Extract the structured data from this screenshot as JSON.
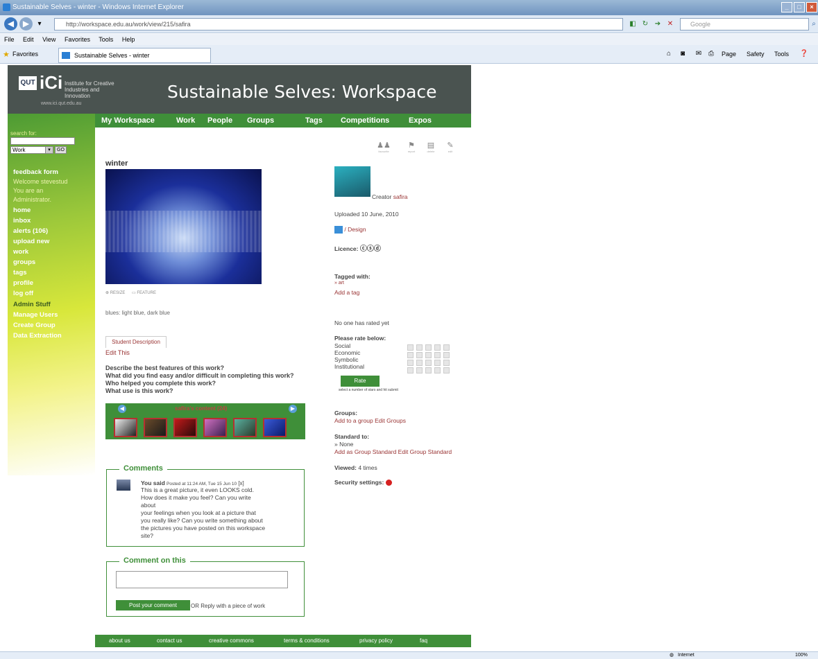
{
  "browser": {
    "title": "Sustainable Selves - winter - Windows Internet Explorer",
    "url": "http://workspace.edu.au/work/view/215/safira",
    "search_placeholder": "Google",
    "menu": [
      "File",
      "Edit",
      "View",
      "Favorites",
      "Tools",
      "Help"
    ],
    "favorites_label": "Favorites",
    "tab_title": "Sustainable Selves - winter",
    "command_items": [
      "Page",
      "Safety",
      "Tools"
    ],
    "status_zone": "Internet",
    "zoom": "100%"
  },
  "header": {
    "qut": "QUT",
    "ici": "iCi",
    "institute": "Institute for Creative Industries and Innovation",
    "site_url": "www.ici.qut.edu.au",
    "site_title": "Sustainable Selves: Workspace"
  },
  "topnav": [
    "My Workspace",
    "Work",
    "People",
    "Groups",
    "Tags",
    "Competitions",
    "Expos"
  ],
  "sidebar": {
    "search_label": "search for:",
    "search_type": "Work",
    "go_label": "GO",
    "feedback": "feedback form",
    "welcome": "Welcome stevestud",
    "admin_note_1": "You are an",
    "admin_note_2": "Administrator.",
    "links": [
      "home",
      "inbox",
      "alerts (106)",
      "upload new",
      "work",
      "groups",
      "tags",
      "profile",
      "log off"
    ],
    "admin_stuff": "Admin Stuff",
    "admin_links": [
      "Manage Users",
      "Create Group",
      "Data Extraction"
    ]
  },
  "work": {
    "title": "winter",
    "action_icons": [
      "favourite",
      "report",
      "delete",
      "edit"
    ],
    "media_controls": [
      "RESIZE",
      "FEATURE"
    ],
    "tags_line": "blues: light blue, dark blue",
    "tab_label": "Student Description",
    "edit_label": "Edit This",
    "questions": [
      "Describe the best features of this work?",
      "What did you find easy and/or difficult in completing this work?",
      "Who helped you complete this work?",
      "What use is this work?"
    ],
    "carousel_title": "safira's content (24)"
  },
  "comments": {
    "legend": "Comments",
    "author": "You said",
    "posted": "Posted at 11:24 AM, Tue 15 Jun 10",
    "delete": "[x]",
    "lines": [
      "This is a great picture, it even LOOKS cold.",
      "How does it make you feel? Can you write about",
      "your feelings when you look at a picture that",
      "you really like? Can you write something about",
      "the pictures you have posted on this workspace",
      "site?"
    ]
  },
  "comment_form": {
    "legend": "Comment on this",
    "post_label": "Post your comment",
    "or_reply": "OR Reply with a piece of work"
  },
  "meta": {
    "creator_label": "Creator",
    "creator_name": "safira",
    "uploaded": "Uploaded 10 June, 2010",
    "category": "/ Design",
    "licence_label": "Licence:",
    "licence_icons": "ⓒⓢⓓ",
    "tagged_label": "Tagged with:",
    "tag": "» art",
    "add_tag": "Add a tag",
    "rated": "No one has rated yet",
    "rate_label": "Please rate below:",
    "rate_criteria": [
      "Social",
      "Economic",
      "Symbolic",
      "Institutional"
    ],
    "rate_button": "Rate",
    "rate_hint": "select a number of stars and hit submit",
    "groups_label": "Groups:",
    "groups_links": "Add to a group Edit Groups",
    "standard_label": "Standard to:",
    "standard_value": "» None",
    "standard_links": "Add as Group Standard Edit Group Standard",
    "viewed_label": "Viewed:",
    "viewed_value": "4 times",
    "security_label": "Security settings:"
  },
  "footer": [
    "about us",
    "contact us",
    "creative commons",
    "terms & conditions",
    "privacy policy",
    "faq"
  ],
  "colors": {
    "header_bg": "#4a5350",
    "nav_green": "#3f8f39",
    "link_red": "#993333"
  }
}
